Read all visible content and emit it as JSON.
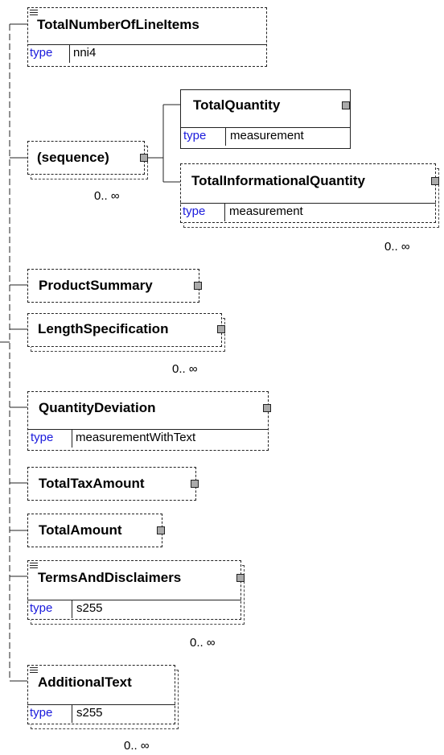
{
  "elements": {
    "total_number_of_line_items": {
      "name": "TotalNumberOfLineItems",
      "type_label": "type",
      "type_value": "nni4"
    },
    "sequence": {
      "name": "(sequence)",
      "cardinality": "0.. ∞"
    },
    "total_quantity": {
      "name": "TotalQuantity",
      "type_label": "type",
      "type_value": "measurement"
    },
    "total_informational_quantity": {
      "name": "TotalInformationalQuantity",
      "type_label": "type",
      "type_value": "measurement",
      "cardinality": "0.. ∞"
    },
    "product_summary": {
      "name": "ProductSummary"
    },
    "length_specification": {
      "name": "LengthSpecification",
      "cardinality": "0.. ∞"
    },
    "quantity_deviation": {
      "name": "QuantityDeviation",
      "type_label": "type",
      "type_value": "measurementWithText"
    },
    "total_tax_amount": {
      "name": "TotalTaxAmount"
    },
    "total_amount": {
      "name": "TotalAmount"
    },
    "terms_and_disclaimers": {
      "name": "TermsAndDisclaimers",
      "type_label": "type",
      "type_value": "s255",
      "cardinality": "0.. ∞"
    },
    "additional_text": {
      "name": "AdditionalText",
      "type_label": "type",
      "type_value": "s255",
      "cardinality": "0.. ∞"
    }
  }
}
